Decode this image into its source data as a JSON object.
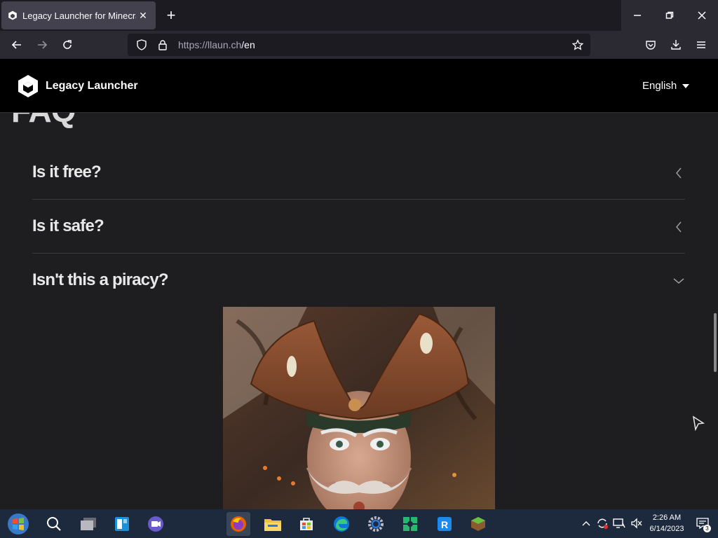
{
  "browser": {
    "tab_title": "Legacy Launcher for Minecraft",
    "url_host": "https://llaun.ch",
    "url_path": "/en",
    "colors": {
      "tabbar": "#1c1b22",
      "navbar": "#2b2a33",
      "active_tab": "#42414d"
    }
  },
  "site": {
    "brand": "Legacy Launcher",
    "language": "English"
  },
  "faq": {
    "heading": "FAQ",
    "items": [
      {
        "question": "Is it free?",
        "state": "collapsed"
      },
      {
        "question": "Is it safe?",
        "state": "collapsed"
      },
      {
        "question": "Isn't this a piracy?",
        "state": "expanded"
      }
    ]
  },
  "taskbar": {
    "apps": [
      "windows-start-icon",
      "search-icon",
      "task-view-icon",
      "widgets-icon",
      "teams-chat-icon",
      "firefox-icon",
      "file-explorer-icon",
      "microsoft-store-icon",
      "edge-icon",
      "settings-icon",
      "app-green-icon",
      "app-blue-icon",
      "minecraft-icon"
    ],
    "time": "2:26 AM",
    "date": "6/14/2023",
    "notifications": "3"
  }
}
